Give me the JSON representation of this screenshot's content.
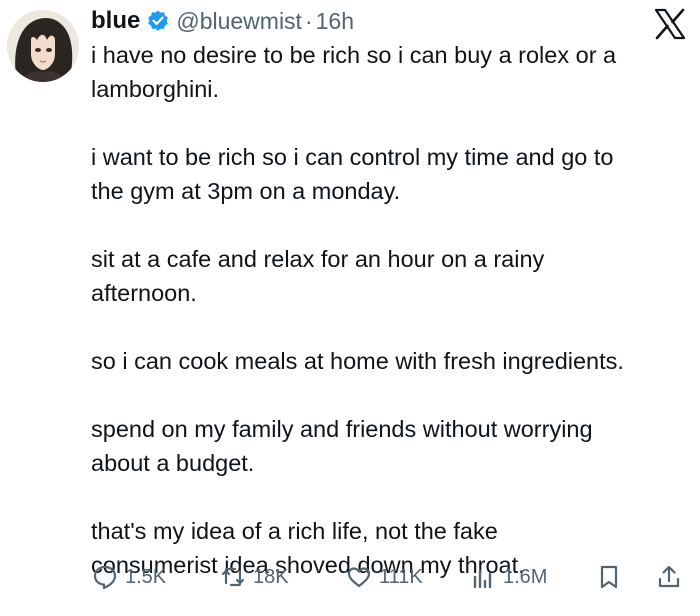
{
  "tweet": {
    "display_name": "blue",
    "handle": "@bluewmist",
    "separator": "·",
    "time": "16h",
    "paragraphs": [
      {
        "lines": [
          "i have no desire to be rich so i can buy a rolex or a",
          "lamborghini."
        ]
      },
      {
        "lines": [
          "i want to be rich so i can control my time and go to",
          "the gym at 3pm on a monday."
        ]
      },
      {
        "lines": [
          "sit at a cafe and relax for an hour on a rainy",
          "afternoon."
        ]
      },
      {
        "lines": [
          "so i can cook meals at home with fresh ingredients."
        ]
      },
      {
        "lines": [
          "spend on my family and friends without worrying",
          "about a budget."
        ]
      },
      {
        "lines": [
          "that's my idea of a rich life, not the fake",
          "consumerist idea shoved down my throat."
        ]
      }
    ]
  },
  "actions": {
    "reply": {
      "icon": "reply-icon",
      "count": "1.5K"
    },
    "repost": {
      "icon": "repost-icon",
      "count": "18K"
    },
    "like": {
      "icon": "heart-icon",
      "count": "111K"
    },
    "views": {
      "icon": "views-chart-icon",
      "count": "1.6M"
    },
    "bookmark": {
      "icon": "bookmark-icon"
    },
    "share": {
      "icon": "share-icon"
    }
  },
  "colors": {
    "text": "#0f1419",
    "secondary": "#536471",
    "verified": "#1d9bf0"
  }
}
